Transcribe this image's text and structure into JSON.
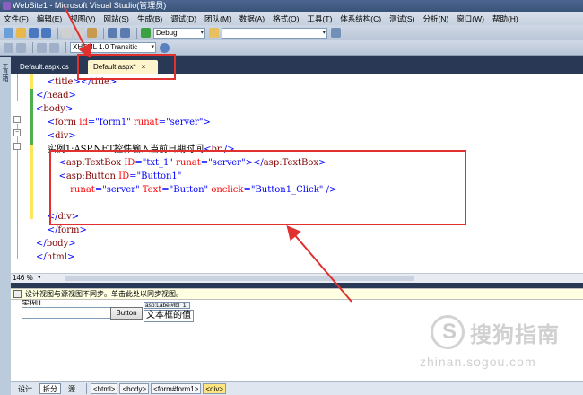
{
  "window": {
    "title": "WebSite1 - Microsoft Visual Studio(管理员)"
  },
  "menu": {
    "items": [
      "文件(F)",
      "编辑(E)",
      "视图(V)",
      "网站(S)",
      "生成(B)",
      "调试(D)",
      "团队(M)",
      "数据(A)",
      "格式(O)",
      "工具(T)",
      "体系结构(C)",
      "测试(S)",
      "分析(N)",
      "窗口(W)",
      "帮助(H)"
    ]
  },
  "toolbar": {
    "config": "Debug",
    "schema": "XHTML 1.0 Transitic"
  },
  "side_panel": {
    "label": "工具箱"
  },
  "tabs": [
    {
      "label": "Default.aspx.cs",
      "active": false
    },
    {
      "label": "Default.aspx*",
      "active": true,
      "close": "×"
    }
  ],
  "code_lines": [
    {
      "indent": "    ",
      "parts": [
        [
          "brk",
          "<"
        ],
        [
          "tag",
          "title"
        ],
        [
          "brk",
          "></"
        ],
        [
          "tag",
          "title"
        ],
        [
          "brk",
          ">"
        ]
      ]
    },
    {
      "indent": "",
      "parts": [
        [
          "brk",
          "</"
        ],
        [
          "tag",
          "head"
        ],
        [
          "brk",
          ">"
        ]
      ]
    },
    {
      "indent": "",
      "parts": [
        [
          "brk",
          "<"
        ],
        [
          "tag",
          "body"
        ],
        [
          "brk",
          ">"
        ]
      ]
    },
    {
      "indent": "    ",
      "parts": [
        [
          "brk",
          "<"
        ],
        [
          "tag",
          "form "
        ],
        [
          "attr",
          "id"
        ],
        [
          "brk",
          "="
        ],
        [
          "val",
          "\"form1\" "
        ],
        [
          "attr",
          "runat"
        ],
        [
          "brk",
          "="
        ],
        [
          "val",
          "\"server\""
        ],
        [
          "brk",
          ">"
        ]
      ]
    },
    {
      "indent": "    ",
      "parts": [
        [
          "brk",
          "<"
        ],
        [
          "tag",
          "div"
        ],
        [
          "brk",
          ">"
        ]
      ]
    },
    {
      "indent": "    ",
      "parts": [
        [
          "txt",
          "实例1:ASP.NET控件输入当前日期时间"
        ],
        [
          "brk",
          "<"
        ],
        [
          "tag",
          "br "
        ],
        [
          "brk",
          "/>"
        ]
      ]
    },
    {
      "indent": "        ",
      "parts": [
        [
          "brk",
          "<"
        ],
        [
          "tag",
          "asp:TextBox "
        ],
        [
          "attr",
          "ID"
        ],
        [
          "brk",
          "="
        ],
        [
          "val",
          "\"txt_1\" "
        ],
        [
          "attr",
          "runat"
        ],
        [
          "brk",
          "="
        ],
        [
          "val",
          "\"server\""
        ],
        [
          "brk",
          "></"
        ],
        [
          "tag",
          "asp:TextBox"
        ],
        [
          "brk",
          ">"
        ]
      ]
    },
    {
      "indent": "        ",
      "parts": [
        [
          "brk",
          "<"
        ],
        [
          "tag",
          "asp:Button "
        ],
        [
          "attr",
          "ID"
        ],
        [
          "brk",
          "="
        ],
        [
          "val",
          "\"Button1\""
        ]
      ]
    },
    {
      "indent": "            ",
      "parts": [
        [
          "attr",
          "runat"
        ],
        [
          "brk",
          "="
        ],
        [
          "val",
          "\"server\" "
        ],
        [
          "attr",
          "Text"
        ],
        [
          "brk",
          "="
        ],
        [
          "val",
          "\"Button\" "
        ],
        [
          "attr",
          "onclick"
        ],
        [
          "brk",
          "="
        ],
        [
          "val",
          "\"Button1_Click\" "
        ],
        [
          "brk",
          "/>"
        ]
      ]
    },
    {
      "indent": "",
      "parts": []
    },
    {
      "indent": "    ",
      "parts": [
        [
          "brk",
          "</"
        ],
        [
          "tag",
          "div"
        ],
        [
          "brk",
          ">"
        ]
      ]
    },
    {
      "indent": "    ",
      "parts": [
        [
          "brk",
          "</"
        ],
        [
          "tag",
          "form"
        ],
        [
          "brk",
          ">"
        ]
      ]
    },
    {
      "indent": "",
      "parts": [
        [
          "brk",
          "</"
        ],
        [
          "tag",
          "body"
        ],
        [
          "brk",
          ">"
        ]
      ]
    },
    {
      "indent": "",
      "parts": [
        [
          "brk",
          "</"
        ],
        [
          "tag",
          "html"
        ],
        [
          "brk",
          ">"
        ]
      ]
    }
  ],
  "editor": {
    "zoom": "146 %"
  },
  "infobar": {
    "message": "设计视图与源视图不同步。单击此处以同步视图。"
  },
  "design_view": {
    "cut_text": "实例1.",
    "button_label": "Button",
    "label_tag": "asp:Label#lbl_1",
    "label_text": "文本框的值"
  },
  "watermark": {
    "brand": "搜狗指南",
    "url": "zhinan.sogou.com"
  },
  "bottom": {
    "views": [
      "设计",
      "拆分",
      "源"
    ],
    "breadcrumbs": [
      "<html>",
      "<body>",
      "<form#form1>",
      "<div>"
    ]
  },
  "colors": {
    "annotation": "#e03030",
    "ide_frame": "#293955"
  }
}
